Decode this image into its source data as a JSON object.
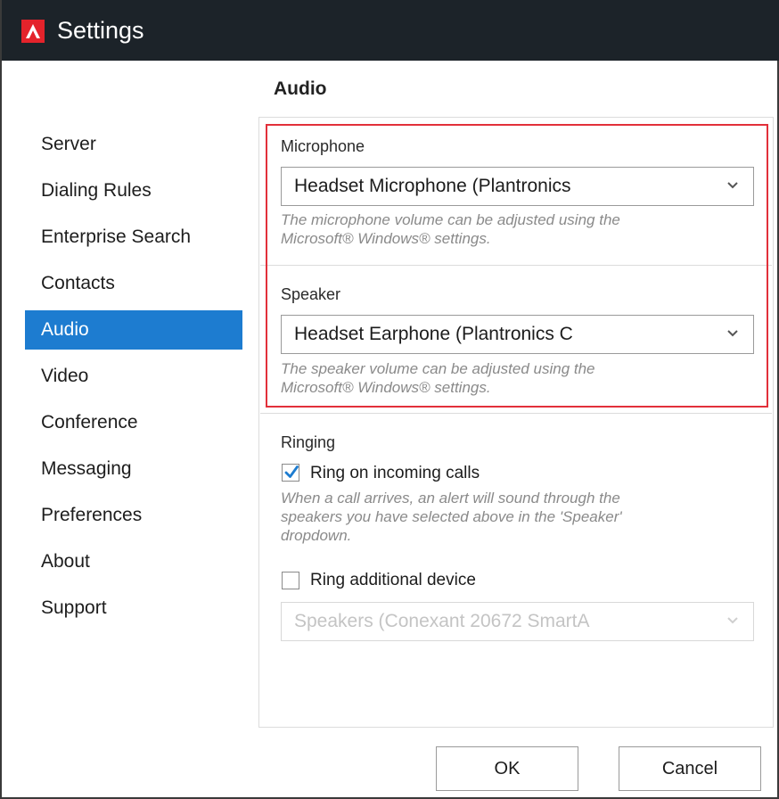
{
  "window": {
    "title": "Settings",
    "logo_icon": "app-logo-a-icon"
  },
  "page": {
    "heading": "Audio"
  },
  "sidebar": {
    "items": [
      {
        "label": "Server"
      },
      {
        "label": "Dialing Rules"
      },
      {
        "label": "Enterprise Search"
      },
      {
        "label": "Contacts"
      },
      {
        "label": "Audio",
        "selected": true
      },
      {
        "label": "Video"
      },
      {
        "label": "Conference"
      },
      {
        "label": "Messaging"
      },
      {
        "label": "Preferences"
      },
      {
        "label": "About"
      },
      {
        "label": "Support"
      }
    ]
  },
  "microphone": {
    "label": "Microphone",
    "selected": "Headset Microphone (Plantronics",
    "hint_line1": "The microphone volume can be adjusted using the",
    "hint_line2": "Microsoft® Windows® settings."
  },
  "speaker": {
    "label": "Speaker",
    "selected": "Headset Earphone (Plantronics C",
    "hint_line1": "The speaker volume can be adjusted using the",
    "hint_line2": "Microsoft® Windows® settings."
  },
  "ringing": {
    "label": "Ringing",
    "ring_incoming": {
      "label": "Ring on incoming calls",
      "checked": true,
      "hint_line1": "When a call arrives, an alert will sound through the",
      "hint_line2": "speakers you have selected above in the 'Speaker'",
      "hint_line3": "dropdown."
    },
    "ring_additional": {
      "label": "Ring additional device",
      "checked": false,
      "device": "Speakers (Conexant 20672 SmartA"
    }
  },
  "buttons": {
    "ok": "OK",
    "cancel": "Cancel"
  },
  "colors": {
    "titlebar": "#1c2329",
    "accent_blue": "#1d7cd0",
    "highlight_red": "#e2303a",
    "logo_red": "#e4232b"
  }
}
